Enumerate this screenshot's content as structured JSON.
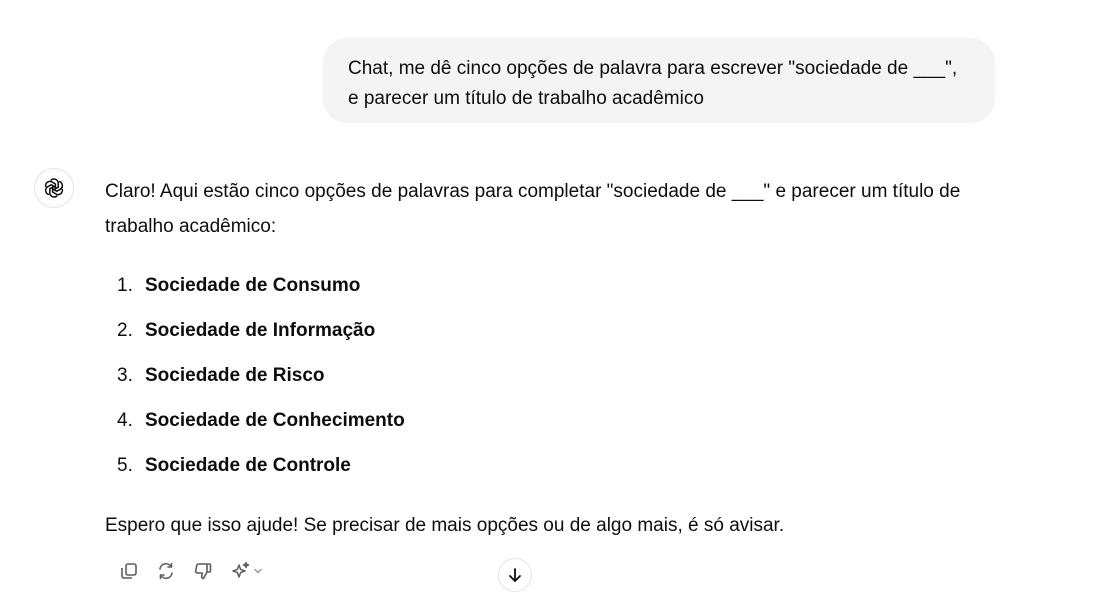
{
  "user_message": {
    "lines": [
      "Chat, me dê cinco opções de palavra para escrever \"sociedade de ___\",",
      "e parecer um título de trabalho acadêmico"
    ]
  },
  "assistant_message": {
    "intro_lines": [
      "Claro! Aqui estão cinco opções de palavras para completar \"sociedade de ___\" e parecer um título de",
      "trabalho acadêmico:"
    ],
    "options": [
      {
        "number": "1.",
        "label": "Sociedade de Consumo"
      },
      {
        "number": "2.",
        "label": "Sociedade de Informação"
      },
      {
        "number": "3.",
        "label": "Sociedade de Risco"
      },
      {
        "number": "4.",
        "label": "Sociedade de Conhecimento"
      },
      {
        "number": "5.",
        "label": "Sociedade de Controle"
      }
    ],
    "outro": "Espero que isso ajude! Se precisar de mais opções ou de algo mais, é só avisar."
  },
  "actions": {
    "icons": [
      "copy-icon",
      "regenerate-icon",
      "thumbs-down-icon",
      "sparkle-model-icon",
      "chevron-down-icon"
    ]
  },
  "scroll_button": {
    "icon": "arrow-down-icon"
  },
  "colors": {
    "user_bubble_bg": "#f4f4f4",
    "text": "#0d0d0d",
    "icon": "#5d5d5d",
    "border": "#e3e3e3"
  }
}
